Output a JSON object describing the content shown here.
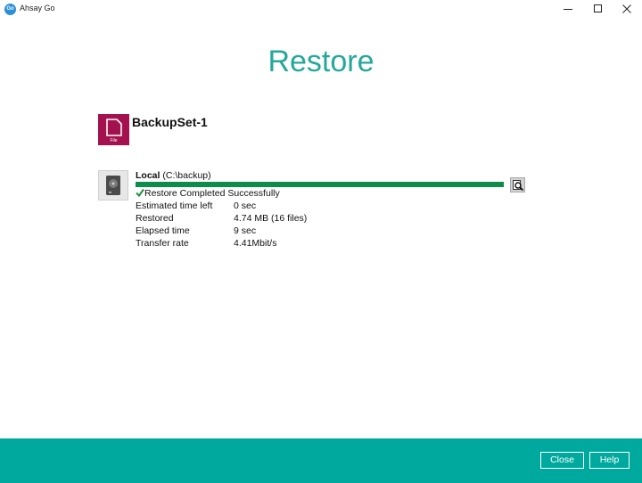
{
  "window": {
    "app_title": "Ahsay Go",
    "app_icon_text": "Go"
  },
  "header": {
    "title": "Restore"
  },
  "backup_set": {
    "name": "BackupSet-1",
    "icon_label": "File",
    "icon": "file-icon",
    "icon_color": "#a3124f"
  },
  "destination": {
    "name": "Local",
    "path": "(C:\\backup)",
    "icon": "hard-drive-icon",
    "progress_percent": 100,
    "progress_color": "#0d8c4c",
    "status": "Restore Completed Successfully",
    "status_icon": "check-icon",
    "stats": [
      {
        "label": "Estimated time left",
        "value": "0 sec"
      },
      {
        "label": "Restored",
        "value": "4.74 MB (16 files)"
      },
      {
        "label": "Elapsed time",
        "value": "9 sec"
      },
      {
        "label": "Transfer rate",
        "value": "4.41Mbit/s"
      }
    ]
  },
  "footer": {
    "close_label": "Close",
    "help_label": "Help",
    "background": "#00a99d"
  },
  "colors": {
    "accent": "#25a89a"
  }
}
